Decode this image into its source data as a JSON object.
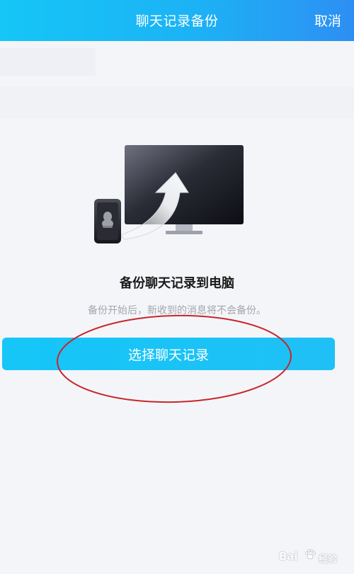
{
  "header": {
    "title": "聊天记录备份",
    "cancel_label": "取消"
  },
  "main": {
    "heading": "备份聊天记录到电脑",
    "subtext": "备份开始后，新收到的消息将不会备份。",
    "primary_button_label": "选择聊天记录"
  },
  "icons": {
    "illustration": "phone-to-computer-upload-icon",
    "phone_logo": "qq-penguin-icon",
    "annotation": "red-ellipse-highlight"
  },
  "colors": {
    "accent": "#1cbff6",
    "annotation": "#c8262a",
    "background": "#f4f5f9"
  },
  "watermark": {
    "brand": "Bai",
    "subtitle": "经验"
  }
}
